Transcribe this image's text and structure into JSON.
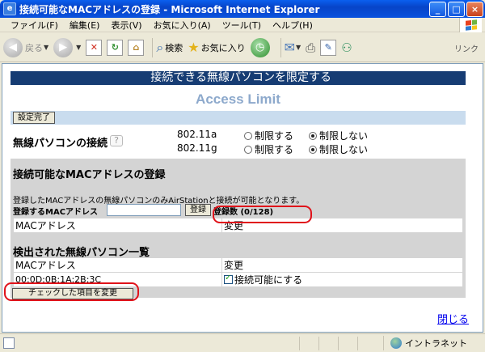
{
  "window": {
    "title": "接続可能なMACアドレスの登録 - Microsoft Internet Explorer",
    "controls": [
      "_",
      "□",
      "×"
    ]
  },
  "menu": [
    "ファイル(F)",
    "編集(E)",
    "表示(V)",
    "お気に入り(A)",
    "ツール(T)",
    "ヘルプ(H)"
  ],
  "toolbar": {
    "back": "戻る",
    "search": "検索",
    "favorites": "お気に入り",
    "links": "リンク"
  },
  "page": {
    "heading": "接続できる無線パソコンを限定する",
    "subtitle": "Access Limit",
    "save_button": "設定完了",
    "wireless": {
      "label": "無線パソコンの接続",
      "bands": [
        "802.11a",
        "802.11g"
      ],
      "option_on": "制限する",
      "option_off": "制限しない",
      "selected": [
        "制限しない",
        "制限しない"
      ]
    },
    "register": {
      "title": "接続可能なMACアドレスの登録",
      "description": "登録したMACアドレスの無線パソコンのみAirStationと接続が可能となります。",
      "input_label": "登録するMACアドレス",
      "input_value": "",
      "button": "登録",
      "count_label": "登録数 (0/128)",
      "table_headers": [
        "MACアドレス",
        "変更"
      ]
    },
    "detected": {
      "title": "検出された無線パソコン一覧",
      "table_headers": [
        "MACアドレス",
        "変更"
      ],
      "rows": [
        {
          "mac": "00:0D:0B:1A:2B:3C",
          "action": "接続可能にする",
          "checked": true
        }
      ],
      "change_button": "チェックした項目を変更"
    },
    "close_link": "閉じる"
  },
  "statusbar": {
    "zone": "イントラネット"
  },
  "colors": {
    "heading_bg": "#163C73",
    "subtitle": "#8DA9CC",
    "highlight": "#E0121A"
  }
}
